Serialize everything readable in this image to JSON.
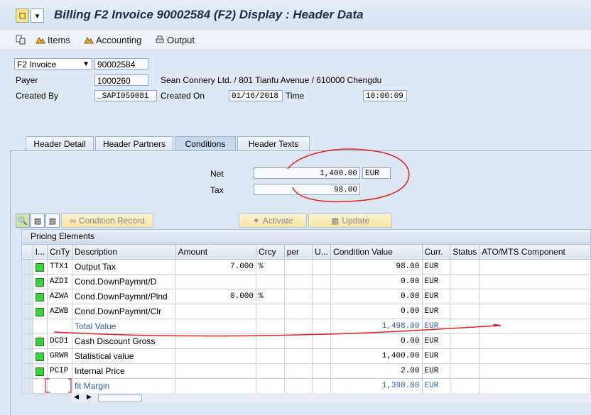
{
  "window": {
    "title": "Billing F2 Invoice 90002584   (F2) Display : Header Data"
  },
  "toolbar": {
    "items": "Items",
    "accounting": "Accounting",
    "output": "Output"
  },
  "header": {
    "doc_type": "F2 Invoice",
    "doc_number": "90002584",
    "payer_label": "Payer",
    "payer_value": "1000260",
    "payer_desc": "Sean Connery Ltd. / 801 Tianfu Avenue / 610000 Chengdu",
    "created_by_label": "Created By",
    "created_by_value": "_SAPI059081",
    "created_on_label": "Created On",
    "created_on_value": "01/16/2018",
    "time_label": "Time",
    "time_value": "10:00:09"
  },
  "tabs": [
    "Header Detail",
    "Header Partners",
    "Conditions",
    "Header Texts"
  ],
  "conditions": {
    "net_label": "Net",
    "net_value": "1,400.00",
    "net_currency": "EUR",
    "tax_label": "Tax",
    "tax_value": "98.00"
  },
  "buttons": {
    "condition_record": "Condition Record",
    "activate": "Activate",
    "update": "Update"
  },
  "pricing": {
    "title": "Pricing Elements",
    "columns": [
      "I...",
      "CnTy",
      "Description",
      "Amount",
      "Crcy",
      "per",
      "U...",
      "Condition Value",
      "Curr.",
      "Status",
      "ATO/MTS Component"
    ],
    "rows": [
      {
        "status": true,
        "cnty": "TTX1",
        "desc": "Output Tax",
        "amount": "7.000",
        "crcy": "%",
        "value": "98.00",
        "curr": "EUR",
        "sub": false
      },
      {
        "status": true,
        "cnty": "AZDI",
        "desc": "Cond.DownPaymnt/D",
        "amount": "",
        "crcy": "",
        "value": "0.00",
        "curr": "EUR",
        "sub": false
      },
      {
        "status": true,
        "cnty": "AZWA",
        "desc": "Cond.DownPaymnt/Plnd",
        "amount": "0.000",
        "crcy": "%",
        "value": "0.00",
        "curr": "EUR",
        "sub": false
      },
      {
        "status": true,
        "cnty": "AZWB",
        "desc": "Cond.DownPaymnt/Clr",
        "amount": "",
        "crcy": "",
        "value": "0.00",
        "curr": "EUR",
        "sub": false
      },
      {
        "status": false,
        "cnty": "",
        "desc": "Total Value",
        "amount": "",
        "crcy": "",
        "value": "1,498.00",
        "curr": "EUR",
        "sub": true
      },
      {
        "status": true,
        "cnty": "DCD1",
        "desc": "Cash Discount Gross",
        "amount": "",
        "crcy": "",
        "value": "0.00",
        "curr": "EUR",
        "sub": false
      },
      {
        "status": true,
        "cnty": "GRWR",
        "desc": "Statistical value",
        "amount": "",
        "crcy": "",
        "value": "1,400.00",
        "curr": "EUR",
        "sub": false
      },
      {
        "status": true,
        "cnty": "PCIP",
        "desc": "Internal Price",
        "amount": "",
        "crcy": "",
        "value": "2.00",
        "curr": "EUR",
        "sub": false
      },
      {
        "status": false,
        "cnty": "",
        "desc": "fit Margin",
        "amount": "",
        "crcy": "",
        "value": "1,398.00",
        "curr": "EUR",
        "sub": true
      }
    ]
  },
  "colors": {
    "annotation": "#e0201e",
    "status_green": "#3fcf3f",
    "link_blue": "#2b5fa6"
  }
}
